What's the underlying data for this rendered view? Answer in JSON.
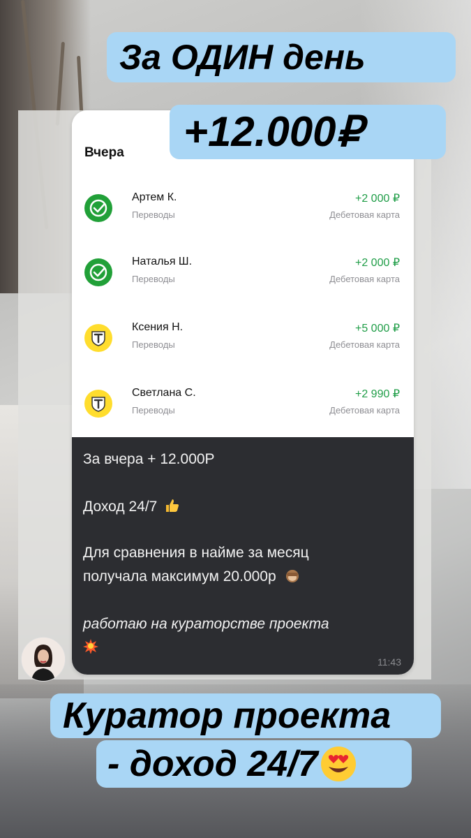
{
  "banners": {
    "line1": "За ОДИН день",
    "line2": "+12.000₽",
    "line3": "Куратор проекта",
    "line4": "- доход 24/7"
  },
  "history": {
    "section_title": "Вчера",
    "transactions": [
      {
        "name": "Артем К.",
        "category": "Переводы",
        "amount": "+2 000 ₽",
        "account": "Дебетовая карта",
        "icon": "sber-check-icon"
      },
      {
        "name": "Наталья Ш.",
        "category": "Переводы",
        "amount": "+2 000 ₽",
        "account": "Дебетовая карта",
        "icon": "sber-check-icon"
      },
      {
        "name": "Ксения Н.",
        "category": "Переводы",
        "amount": "+5 000 ₽",
        "account": "Дебетовая карта",
        "icon": "tbank-shield-icon"
      },
      {
        "name": "Светлана С.",
        "category": "Переводы",
        "amount": "+2 990 ₽",
        "account": "Дебетовая карта",
        "icon": "tbank-shield-icon"
      }
    ]
  },
  "message": {
    "line1": "За вчера + 12.000Р",
    "line2": "Доход 24/7",
    "line3": "Для сравнения в найме за месяц",
    "line4": "получала максимум 20.000р",
    "line5": "работаю на кураторстве проекта",
    "time": "11:43"
  },
  "colors": {
    "banner": "#a9d6f5",
    "income_green": "#1f9d47",
    "sber_green": "#21a038",
    "tbank_yellow": "#ffdd2d",
    "chat_bubble": "#2c2d31"
  }
}
